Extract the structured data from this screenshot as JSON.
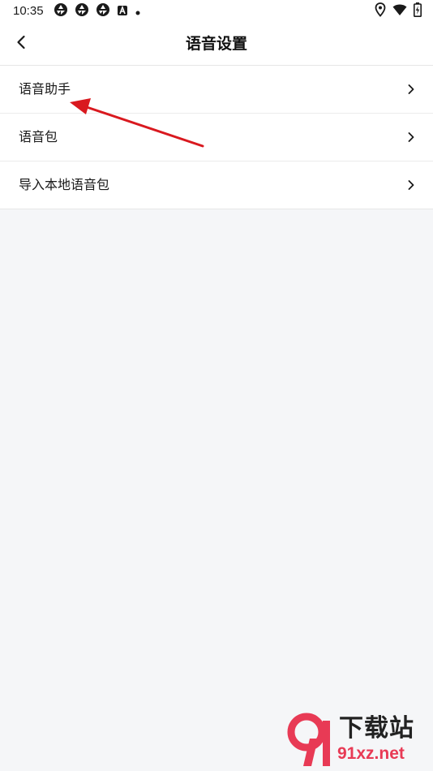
{
  "status_bar": {
    "time": "10:35",
    "left_icons": [
      "aperture-icon",
      "aperture-icon",
      "aperture-icon",
      "a-badge-icon",
      "dot-icon"
    ],
    "right_icons": [
      "location-icon",
      "wifi-icon",
      "battery-icon"
    ]
  },
  "header": {
    "title": "语音设置",
    "back_icon": "chevron-left-icon"
  },
  "menu": {
    "items": [
      {
        "label": "语音助手",
        "icon": "chevron-right-icon"
      },
      {
        "label": "语音包",
        "icon": "chevron-right-icon"
      },
      {
        "label": "导入本地语音包",
        "icon": "chevron-right-icon"
      }
    ]
  },
  "annotation": {
    "color": "#d9191f"
  },
  "watermark": {
    "line1": "下载站",
    "line2": "91xz.net"
  },
  "colors": {
    "background": "#f5f6f8",
    "surface": "#ffffff",
    "divider": "#ececec",
    "watermark_accent": "#e83a55"
  }
}
